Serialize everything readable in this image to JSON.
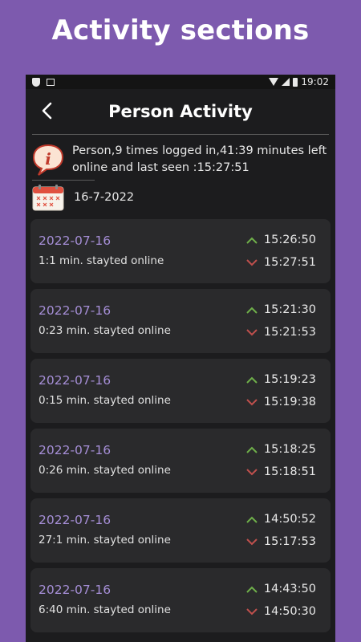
{
  "banner": {
    "title": "Activity sections"
  },
  "status_bar": {
    "time": "19:02"
  },
  "header": {
    "title": "Person Activity"
  },
  "summary": {
    "text": "Person,9 times logged in,41:39 minutes left online and last seen :15:27:51"
  },
  "date": {
    "text": "16-7-2022"
  },
  "colors": {
    "background": "#7d5aae",
    "date_accent": "#a58ed6",
    "login_green": "#6fb04a",
    "logout_red": "#c0504d"
  },
  "icons": {
    "back": "back-arrow-icon",
    "info": "info-speech-bubble-icon",
    "calendar": "calendar-icon",
    "up": "chevron-up-icon",
    "down": "chevron-down-icon"
  },
  "sessions": [
    {
      "date": "2022-07-16",
      "duration": "1:1 min. stayted online",
      "login": "15:26:50",
      "logout": "15:27:51"
    },
    {
      "date": "2022-07-16",
      "duration": "0:23 min. stayted online",
      "login": "15:21:30",
      "logout": "15:21:53"
    },
    {
      "date": "2022-07-16",
      "duration": "0:15 min. stayted online",
      "login": "15:19:23",
      "logout": "15:19:38"
    },
    {
      "date": "2022-07-16",
      "duration": "0:26 min. stayted online",
      "login": "15:18:25",
      "logout": "15:18:51"
    },
    {
      "date": "2022-07-16",
      "duration": "27:1 min. stayted online",
      "login": "14:50:52",
      "logout": "15:17:53"
    },
    {
      "date": "2022-07-16",
      "duration": "6:40 min. stayted online",
      "login": "14:43:50",
      "logout": "14:50:30"
    }
  ]
}
